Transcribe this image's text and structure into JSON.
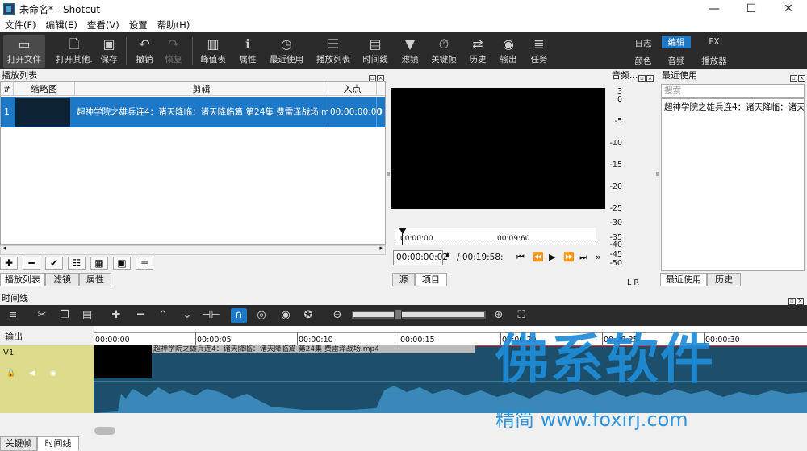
{
  "window": {
    "title": "未命名* - Shotcut",
    "min": "—",
    "max": "☐",
    "close": "✕"
  },
  "menu": [
    "文件(F)",
    "编辑(E)",
    "查看(V)",
    "设置",
    "帮助(H)"
  ],
  "toolbar": {
    "open": "打开文件",
    "open_other": "打开其他.",
    "save": "保存",
    "undo": "撤销",
    "redo": "恢复",
    "peak": "峰值表",
    "properties": "属性",
    "recent": "最近使用",
    "playlist": "播放列表",
    "timeline": "时间线",
    "filters": "滤镜",
    "keyframes": "关键帧",
    "history": "历史",
    "output": "输出",
    "jobs": "任务"
  },
  "modes": {
    "log": "日志",
    "edit": "编辑",
    "fx": "FX",
    "color": "颜色",
    "audio": "音频",
    "player": "播放器"
  },
  "playlist": {
    "title": "播放列表",
    "headers": [
      "#",
      "缩略图",
      "剪辑",
      "入点"
    ],
    "rows": [
      {
        "index": "1",
        "clip": "超神学院之雄兵连4：诸天降临：诸天降临篇 第24集 费雷泽战场.mp4",
        "in": "00:00:00:00"
      }
    ],
    "tabs": [
      "播放列表",
      "滤镜",
      "属性"
    ]
  },
  "player": {
    "ruler_start": "00:00:00",
    "ruler_mid": "00:09:60",
    "position": "00:00:00:02",
    "duration": "/ 00:19:58:",
    "tabs": [
      "源",
      "项目"
    ]
  },
  "meter": {
    "title": "音频...",
    "scale": [
      "3",
      "0",
      "-5",
      "-10",
      "-15",
      "-20",
      "-25",
      "-30",
      "-35",
      "-40",
      "-45",
      "-50"
    ],
    "channels": "L  R"
  },
  "recent": {
    "title": "最近使用",
    "search_placeholder": "搜索",
    "items": [
      "超神学院之雄兵连4：诸天降临：诸天..."
    ],
    "tabs": [
      "最近使用",
      "历史"
    ]
  },
  "timeline": {
    "title": "时间线",
    "output_label": "输出",
    "track": "V1",
    "ticks": [
      "00:00:00",
      "00:00:05",
      "00:00:10",
      "00:00:15",
      "00:00:20",
      "00:00:25",
      "00:00:30"
    ],
    "clip_label": "超神学院之雄兵连4：诸天降临：诸天降临篇 第24集 费雷泽战场.mp4"
  },
  "bottom_tabs": [
    "关键帧",
    "时间线"
  ],
  "watermark": {
    "big": "佛系软件",
    "small": "精简 www.foxirj.com"
  }
}
